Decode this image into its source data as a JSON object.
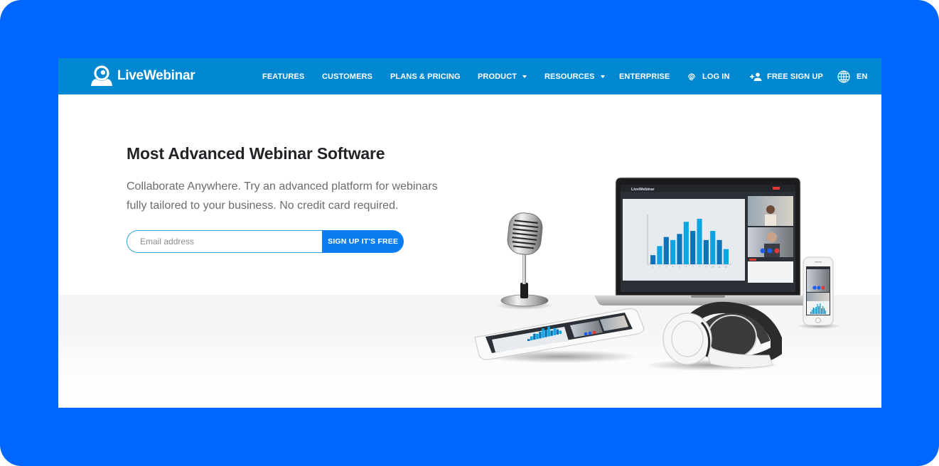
{
  "brand": {
    "name": "LiveWebinar",
    "frame_color": "#0066ff",
    "nav_color": "#0288d1",
    "button_color": "#0a7ef0"
  },
  "nav": {
    "items": [
      {
        "label": "FEATURES",
        "dropdown": false
      },
      {
        "label": "CUSTOMERS",
        "dropdown": false
      },
      {
        "label": "PLANS & PRICING",
        "dropdown": false
      },
      {
        "label": "PRODUCT",
        "dropdown": true
      },
      {
        "label": "RESOURCES",
        "dropdown": true
      },
      {
        "label": "ENTERPRISE",
        "dropdown": false
      }
    ],
    "login": {
      "label": "LOG IN",
      "icon": "fingerprint-icon"
    },
    "signup": {
      "label": "FREE SIGN UP",
      "icon": "add-user-icon"
    },
    "language": {
      "label": "EN",
      "icon": "globe-icon"
    }
  },
  "hero": {
    "title": "Most Advanced Webinar Software",
    "subtitle_line1": "Collaborate Anywhere. Try an advanced platform for webinars",
    "subtitle_line2": "fully tailored to your business. No credit card required.",
    "email_placeholder": "Email address",
    "email_value": "",
    "cta_label": "SIGN UP IT'S FREE"
  },
  "illustration": {
    "items": [
      "microphone",
      "laptop",
      "tablet",
      "headphones",
      "smartphone"
    ],
    "laptop_chart_values": [
      3,
      6,
      9,
      8,
      10,
      14,
      11,
      15,
      8,
      11,
      8,
      5
    ],
    "laptop_chart_x_labels": [
      "1",
      "2",
      "3",
      "4",
      "5",
      "6",
      "7",
      "8",
      "9",
      "10",
      "11",
      "12"
    ],
    "bar_colors": [
      "#0a74b8",
      "#0aa5e2"
    ],
    "end_call_color": "#e53935",
    "call_button_color": "#1e5ef0"
  }
}
